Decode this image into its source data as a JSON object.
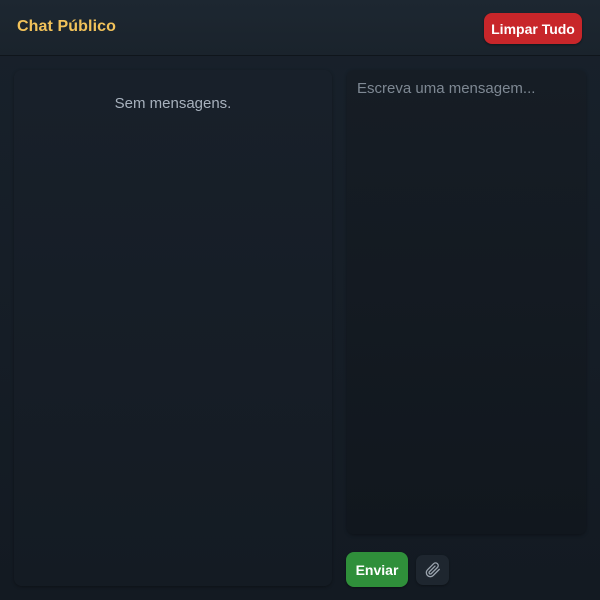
{
  "header": {
    "title": "Chat Público",
    "clear_label": "Limpar Tudo"
  },
  "messages": {
    "empty_text": "Sem mensagens."
  },
  "compose": {
    "placeholder": "Escreva uma mensagem...",
    "value": "",
    "send_label": "Enviar",
    "attach_icon": "paperclip-icon"
  },
  "colors": {
    "title": "#f2c25a",
    "clear_button": "#c8262a",
    "send_button": "#2f8f3a",
    "background": "#151c24"
  }
}
